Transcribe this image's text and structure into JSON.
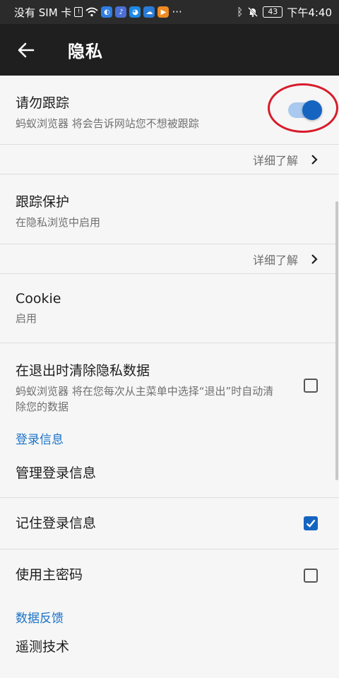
{
  "status_bar": {
    "carrier": "没有 SIM 卡",
    "time": "下午4:40",
    "battery": "43",
    "dots": "···"
  },
  "app_bar": {
    "back_icon": "arrow-left-icon",
    "title": "隐私"
  },
  "settings": {
    "do_not_track": {
      "title": "请勿跟踪",
      "subtitle": "蚂蚁浏览器 将会告诉网站您不想被跟踪",
      "enabled": true
    },
    "learn_more_1": "详细了解",
    "tracking_protection": {
      "title": "跟踪保护",
      "subtitle": "在隐私浏览中启用"
    },
    "learn_more_2": "详细了解",
    "cookie": {
      "title": "Cookie",
      "subtitle": "启用"
    },
    "clear_on_exit": {
      "title": "在退出时清除隐私数据",
      "subtitle": "蚂蚁浏览器 将在您每次从主菜单中选择“退出”时自动清除您的数据",
      "checked": false
    },
    "login_section": "登录信息",
    "manage_logins": "管理登录信息",
    "remember_logins": {
      "title": "记住登录信息",
      "checked": true
    },
    "master_password": {
      "title": "使用主密码",
      "checked": false
    },
    "feedback_section": "数据反馈",
    "telemetry": "遥测技术"
  },
  "colors": {
    "accent": "#1565c0",
    "highlight": "#d81c2b",
    "appbar": "#1f1f1f"
  }
}
